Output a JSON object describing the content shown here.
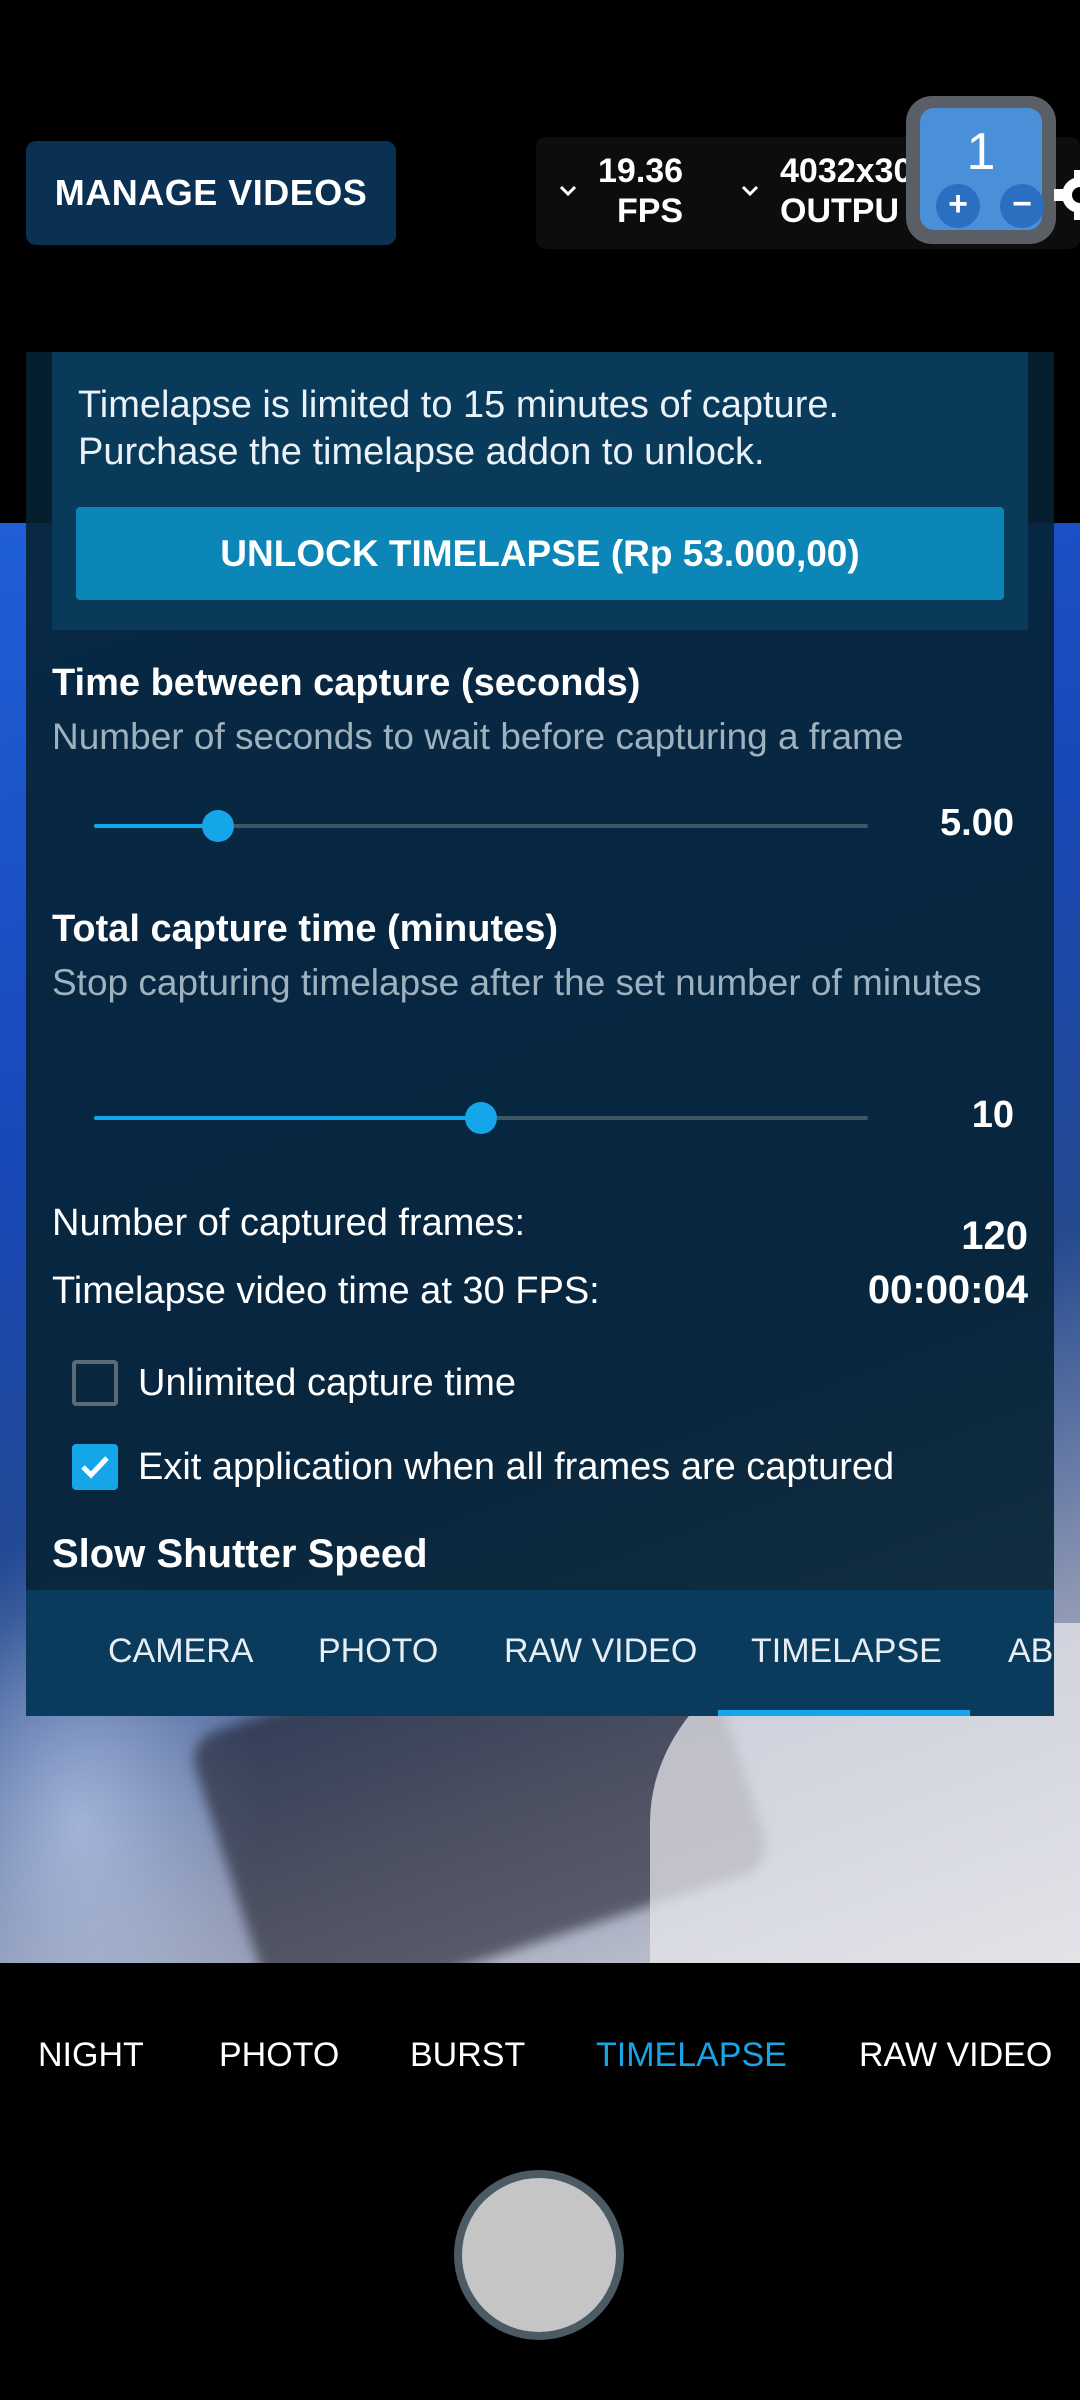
{
  "header": {
    "manage_videos_label": "MANAGE VIDEOS",
    "fps_value": "19.36",
    "fps_unit": "FPS",
    "resolution_value": "4032x30",
    "resolution_unit": "OUTPU",
    "zoom_value": "1",
    "zoom_plus": "+",
    "zoom_minus": "−"
  },
  "panel": {
    "unlock_notice": "Timelapse is limited to 15 minutes of capture. Purchase the timelapse addon to unlock.",
    "unlock_button": "UNLOCK TIMELAPSE (Rp 53.000,00)",
    "time_between": {
      "title": "Time between capture (seconds)",
      "description": "Number of seconds to wait before capturing a frame",
      "value": "5.00",
      "slider_fraction": 0.16
    },
    "total_capture": {
      "title": "Total capture time (minutes)",
      "description": "Stop capturing timelapse after the set number of minutes",
      "value": "10",
      "slider_fraction": 0.5
    },
    "captured_frames_label": "Number of captured frames:",
    "captured_frames_value": "120",
    "video_time_label": "Timelapse video time at 30 FPS:",
    "video_time_value": "00:00:04",
    "unlimited_label": "Unlimited capture time",
    "unlimited_checked": false,
    "exit_label": "Exit application when all frames are captured",
    "exit_checked": true,
    "next_section_title": "Slow Shutter Speed"
  },
  "panel_tabs": [
    "CAMERA",
    "PHOTO",
    "RAW VIDEO",
    "TIMELAPSE",
    "AB"
  ],
  "panel_tab_active": "TIMELAPSE",
  "modes": [
    "NIGHT",
    "PHOTO",
    "BURST",
    "TIMELAPSE",
    "RAW VIDEO"
  ],
  "mode_active": "TIMELAPSE",
  "colors": {
    "accent": "#14a6e8",
    "panel_bg": "#062234",
    "unlock_button": "#0c86b6"
  }
}
